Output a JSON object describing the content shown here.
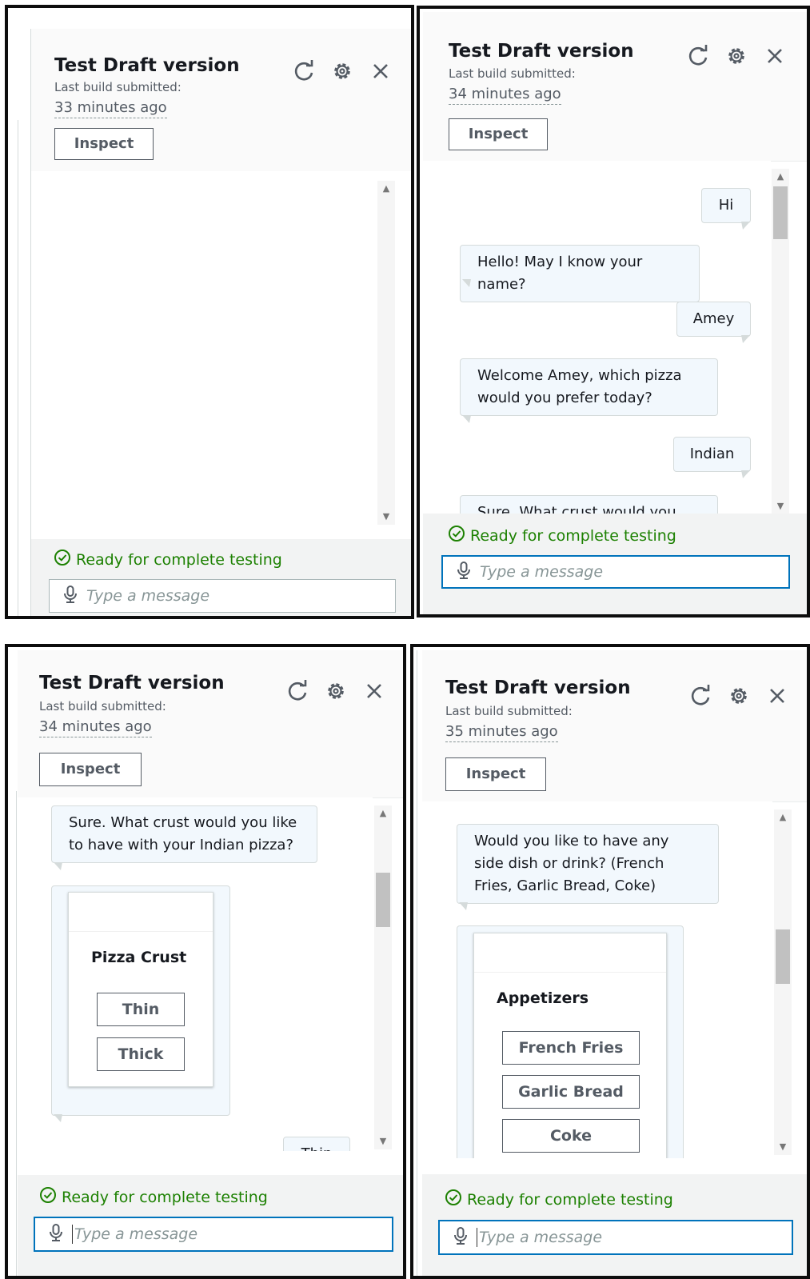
{
  "colors": {
    "frame_border": "#0d0d0d",
    "status_green": "#1d8102",
    "focus_blue": "#0073bb",
    "bubble_bg": "#f2f8fd"
  },
  "icons": [
    "refresh-icon",
    "settings-gear-icon",
    "close-icon",
    "microphone-icon",
    "check-circle-icon"
  ],
  "panels": [
    {
      "title": "Test Draft version",
      "subtitle": "Last build submitted:",
      "time_ago": "33 minutes ago",
      "inspect_label": "Inspect",
      "status": "Ready for complete testing",
      "input_placeholder": "Type a message",
      "input_focused": false
    },
    {
      "title": "Test Draft version",
      "subtitle": "Last build submitted:",
      "time_ago": "34 minutes ago",
      "inspect_label": "Inspect",
      "status": "Ready for complete testing",
      "input_placeholder": "Type a message",
      "input_focused": true,
      "messages": [
        {
          "from": "user",
          "text": "Hi"
        },
        {
          "from": "bot",
          "text": "Hello! May I know your name?"
        },
        {
          "from": "user",
          "text": "Amey"
        },
        {
          "from": "bot",
          "text": "Welcome Amey, which pizza would you prefer today?"
        },
        {
          "from": "user",
          "text": "Indian"
        },
        {
          "from": "bot",
          "text": "Sure. What crust would you like"
        }
      ]
    },
    {
      "title": "Test Draft version",
      "subtitle": "Last build submitted:",
      "time_ago": "34 minutes ago",
      "inspect_label": "Inspect",
      "status": "Ready for complete testing",
      "input_placeholder": "Type a message",
      "input_focused": true,
      "messages": [
        {
          "from": "bot",
          "text": "Sure. What crust would you like to have with your Indian pizza?"
        },
        {
          "from": "user",
          "text": "Thin"
        }
      ],
      "card": {
        "title": "Pizza Crust",
        "buttons": [
          "Thin",
          "Thick"
        ]
      }
    },
    {
      "title": "Test Draft version",
      "subtitle": "Last build submitted:",
      "time_ago": "35 minutes ago",
      "inspect_label": "Inspect",
      "status": "Ready for complete testing",
      "input_placeholder": "Type a message",
      "input_focused": true,
      "messages": [
        {
          "from": "bot",
          "text": "Would you like to have any side dish or drink? (French Fries, Garlic Bread, Coke)"
        }
      ],
      "card": {
        "title": "Appetizers",
        "buttons": [
          "French Fries",
          "Garlic Bread",
          "Coke"
        ]
      }
    }
  ]
}
